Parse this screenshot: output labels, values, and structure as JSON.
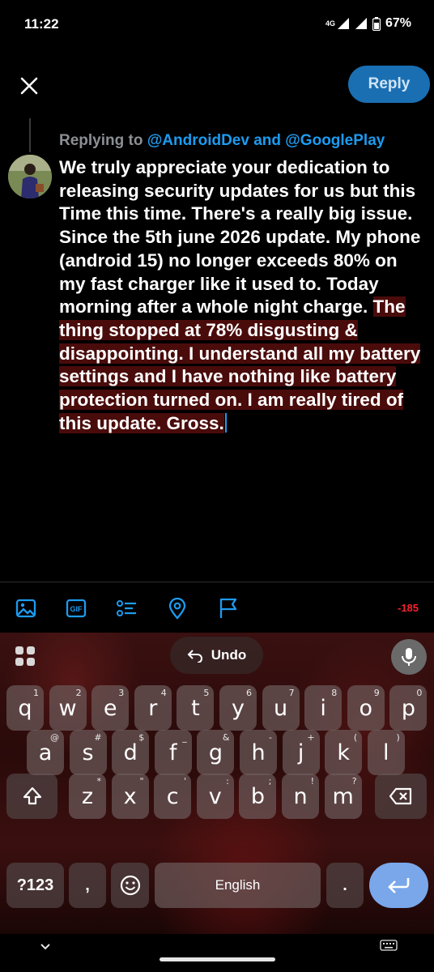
{
  "status_bar": {
    "time": "11:22",
    "network": "4G",
    "battery": "67%"
  },
  "compose": {
    "reply_button": "Reply",
    "replying_prefix": "Replying to ",
    "reply_handle_1": "@AndroidDev",
    "reply_and": " and ",
    "reply_handle_2": "@GooglePlay",
    "text_plain": "We truly appreciate your dedication to releasing security updates for us but this Time this time. There's a really big issue. Since the 5th june 2026 update. My phone (android 15)  no longer exceeds 80% on my fast charger like it used to. Today morning after a whole night charge. ",
    "text_selected": "The thing stopped at 78% disgusting & disappointing. I understand all my battery settings and I have nothing like battery protection turned on. I am really tired of this update. Gross.",
    "char_count": "-185"
  },
  "toolbar": {
    "icons": [
      "image-icon",
      "gif-icon",
      "poll-icon",
      "location-icon",
      "flag-icon"
    ]
  },
  "keyboard": {
    "undo_label": "Undo",
    "row1": [
      {
        "k": "q",
        "h": "1"
      },
      {
        "k": "w",
        "h": "2"
      },
      {
        "k": "e",
        "h": "3"
      },
      {
        "k": "r",
        "h": "4"
      },
      {
        "k": "t",
        "h": "5"
      },
      {
        "k": "y",
        "h": "6"
      },
      {
        "k": "u",
        "h": "7"
      },
      {
        "k": "i",
        "h": "8"
      },
      {
        "k": "o",
        "h": "9"
      },
      {
        "k": "p",
        "h": "0"
      }
    ],
    "row2": [
      {
        "k": "a",
        "h": "@"
      },
      {
        "k": "s",
        "h": "#"
      },
      {
        "k": "d",
        "h": "$"
      },
      {
        "k": "f",
        "h": "_"
      },
      {
        "k": "g",
        "h": "&"
      },
      {
        "k": "h",
        "h": "-"
      },
      {
        "k": "j",
        "h": "+"
      },
      {
        "k": "k",
        "h": "("
      },
      {
        "k": "l",
        "h": ")"
      }
    ],
    "row3": [
      {
        "k": "z",
        "h": "*"
      },
      {
        "k": "x",
        "h": "\""
      },
      {
        "k": "c",
        "h": "'"
      },
      {
        "k": "v",
        "h": ":"
      },
      {
        "k": "b",
        "h": ";"
      },
      {
        "k": "n",
        "h": "!"
      },
      {
        "k": "m",
        "h": "?"
      }
    ],
    "symbols_label": "?123",
    "comma": ",",
    "space_label": "English",
    "period": "."
  }
}
